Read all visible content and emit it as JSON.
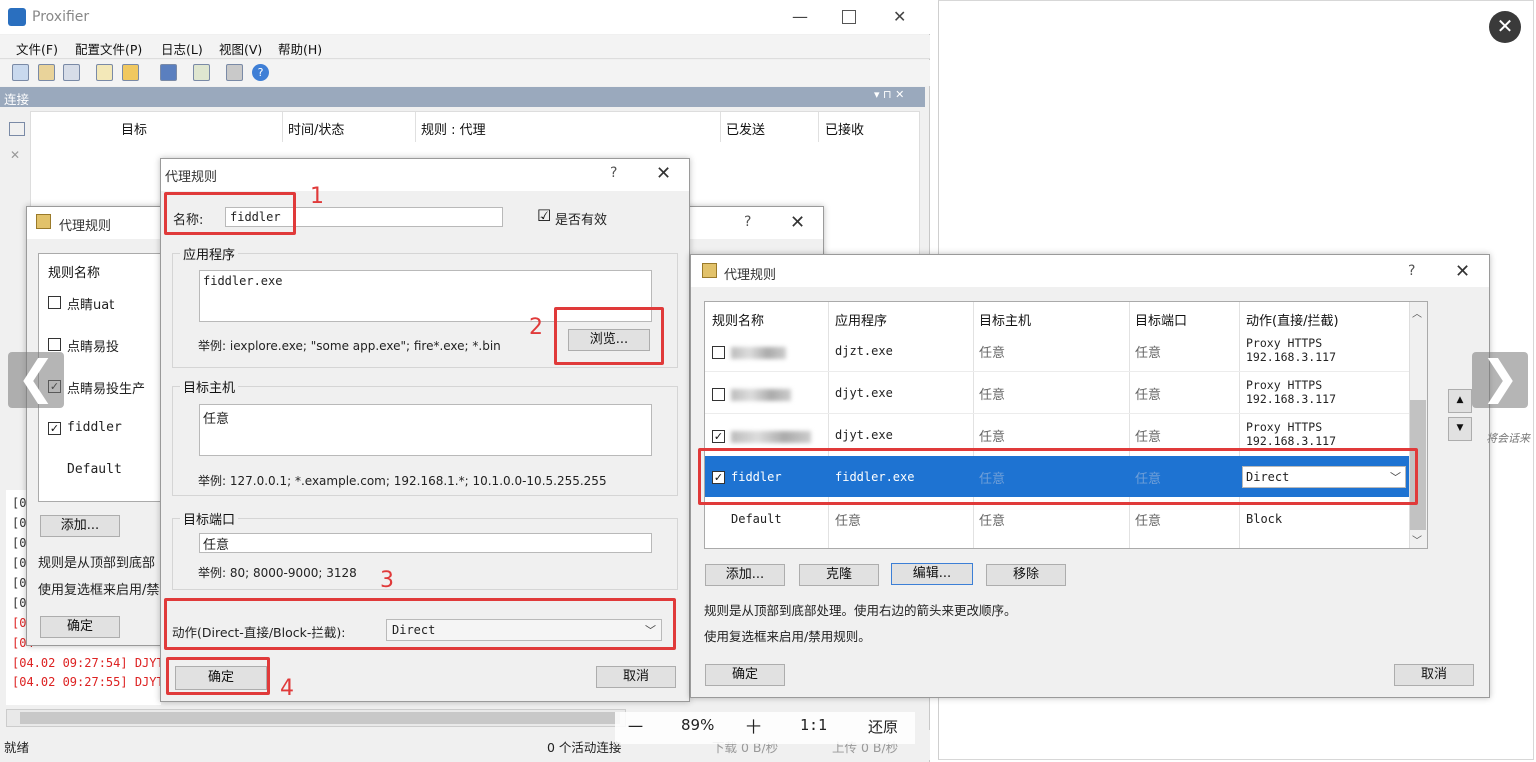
{
  "main_window": {
    "title": "Proxifier",
    "menu": [
      "文件(F)",
      "配置文件(P)",
      "日志(L)",
      "视图(V)",
      "帮助(H)"
    ],
    "connections_title": "连接",
    "columns": [
      "目标",
      "时间/状态",
      "规则 : 代理",
      "已发送",
      "已接收"
    ],
    "log_lines": [
      "[04",
      "[04",
      "[04",
      "[04",
      "[04",
      "[04",
      "[04",
      "[04",
      "[04",
      "[04"
    ],
    "log_red_1": "[04.02 09:27:54] DJYT.",
    "log_red_2": "[04.02 09:27:55] DJYT.",
    "status_left": "就绪",
    "status_active": "0 个活动连接",
    "status_down": "下载 0 B/秒",
    "status_up": "上传 0 B/秒"
  },
  "back_dialog": {
    "title": "代理规则",
    "help": "?",
    "close": "✕",
    "header": "规则名称",
    "rules": [
      {
        "name": "点睛uat",
        "checked": false
      },
      {
        "name": "点睛易投",
        "checked": false
      },
      {
        "name": "点睛易投生产",
        "checked": true
      },
      {
        "name": "fiddler",
        "checked": true
      },
      {
        "name": "Default",
        "checked": null
      }
    ],
    "add_button": "添加...",
    "note_1": "规则是从顶部到底部",
    "note_2": "使用复选框来启用/禁",
    "ok_button": "确定"
  },
  "edit_dialog": {
    "title": "代理规则",
    "help": "?",
    "close": "✕",
    "name_label": "名称:",
    "name_value": "fiddler",
    "enabled_label": "是否有效",
    "enabled_check": "☑",
    "app_group": "应用程序",
    "app_value": "fiddler.exe",
    "app_example": "举例: iexplore.exe; \"some app.exe\"; fire*.exe; *.bin",
    "browse_button": "浏览...",
    "host_group": "目标主机",
    "host_value": "任意",
    "host_example": "举例: 127.0.0.1; *.example.com; 192.168.1.*; 10.1.0.0-10.5.255.255",
    "port_group": "目标端口",
    "port_value": "任意",
    "port_example": "举例: 80; 8000-9000; 3128",
    "action_label": "动作(Direct-直接/Block-拦截):",
    "action_value": "Direct",
    "ok_button": "确定",
    "cancel_button": "取消",
    "annotations": [
      "1",
      "2",
      "3",
      "4"
    ]
  },
  "front_dialog": {
    "title": "代理规则",
    "help": "?",
    "close": "✕",
    "columns": [
      "规则名称",
      "应用程序",
      "目标主机",
      "目标端口",
      "动作(直接/拦截)"
    ],
    "rows": [
      {
        "name": "",
        "checked": false,
        "app": "djzt.exe",
        "host": "任意",
        "port": "任意",
        "action1": "Proxy HTTPS",
        "action2": "192.168.3.117",
        "blurred": true
      },
      {
        "name": "",
        "checked": false,
        "app": "djyt.exe",
        "host": "任意",
        "port": "任意",
        "action1": "Proxy HTTPS",
        "action2": "192.168.3.117",
        "blurred": true
      },
      {
        "name": "",
        "checked": true,
        "app": "djyt.exe",
        "host": "任意",
        "port": "任意",
        "action1": "Proxy HTTPS",
        "action2": "192.168.3.117",
        "blurred": true
      },
      {
        "name": "fiddler",
        "checked": true,
        "app": "fiddler.exe",
        "host": "任意",
        "port": "任意",
        "action1": "Direct",
        "action2": "",
        "selected": true
      },
      {
        "name": "Default",
        "checked": null,
        "app": "任意",
        "host": "任意",
        "port": "任意",
        "action1": "Block",
        "action2": ""
      }
    ],
    "add_button": "添加...",
    "clone_button": "克隆",
    "edit_button": "编辑...",
    "remove_button": "移除",
    "note_1": "规则是从顶部到底部处理。使用右边的箭头来更改顺序。",
    "note_2": "使用复选框来启用/禁用规则。",
    "ok_button": "确定",
    "cancel_button": "取消",
    "side_text": "将会话来"
  },
  "viewer": {
    "close": "✕",
    "prev": "❮",
    "next": "❯",
    "zoom_out": "一",
    "zoom_level": "89%",
    "zoom_in": "十",
    "actual": "1:1",
    "restore": "还原"
  },
  "colors": {
    "annotation_red": "#e03a3a",
    "selection_blue": "#1e73d2",
    "log_red": "#dd2222"
  }
}
